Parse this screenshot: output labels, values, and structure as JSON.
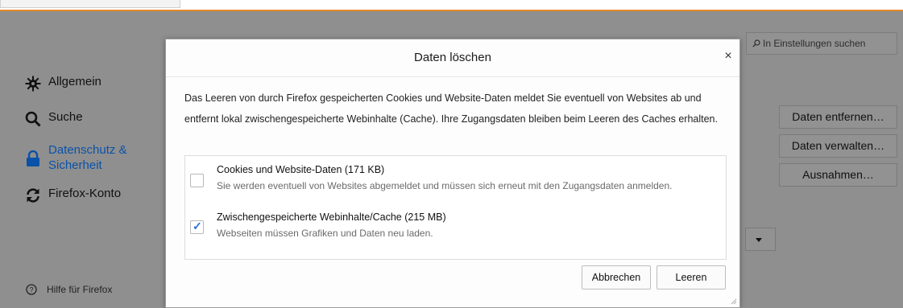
{
  "search": {
    "placeholder": "In Einstellungen suchen"
  },
  "sidebar": {
    "items": [
      {
        "label": "Allgemein",
        "icon": "gear-icon"
      },
      {
        "label": "Suche",
        "icon": "search-icon"
      },
      {
        "label": "Datenschutz &",
        "label2": "Sicherheit",
        "icon": "lock-icon",
        "active": true
      },
      {
        "label": "Firefox-Konto",
        "icon": "sync-icon"
      }
    ],
    "help_label": "Hilfe für Firefox"
  },
  "right_buttons": {
    "remove_data": "Daten entfernen…",
    "manage_data": "Daten verwalten…",
    "exceptions": "Ausnahmen…"
  },
  "dialog": {
    "title": "Daten löschen",
    "description": "Das Leeren von durch Firefox gespeicherten Cookies und Website-Daten meldet Sie eventuell von Websites ab und entfernt lokal zwischengespeicherte Webinhalte (Cache). Ihre Zugangsdaten bleiben beim Leeren des Caches erhalten.",
    "options": [
      {
        "label": "Cookies und Website-Daten (171 KB)",
        "sub": "Sie werden eventuell von Websites abgemeldet und müssen sich erneut mit den Zugangsdaten anmelden.",
        "checked": false
      },
      {
        "label": "Zwischengespeicherte Webinhalte/Cache (215 MB)",
        "sub": "Webseiten müssen Grafiken und Daten neu laden.",
        "checked": true
      }
    ],
    "cancel_label": "Abbrechen",
    "clear_label": "Leeren"
  },
  "colors": {
    "accent": "#0a52a8",
    "overlay": "#8f8f8f",
    "tab_border": "#e38a2a",
    "check": "#2a6fd6"
  }
}
